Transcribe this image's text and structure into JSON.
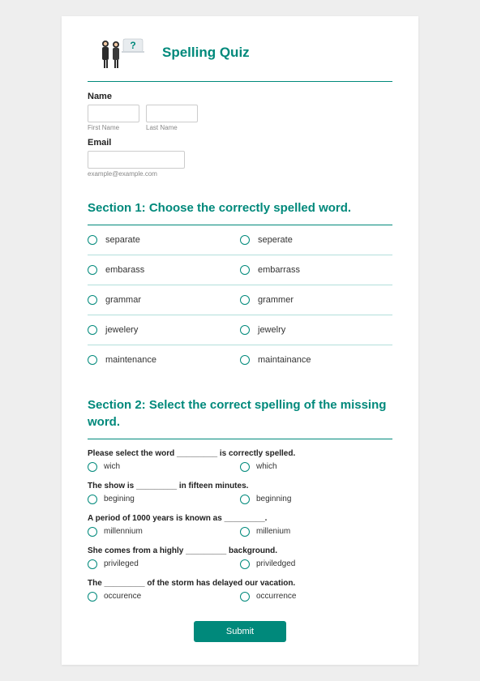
{
  "header": {
    "title": "Spelling Quiz"
  },
  "name": {
    "label": "Name",
    "first_sub": "First Name",
    "last_sub": "Last Name"
  },
  "email": {
    "label": "Email",
    "hint": "example@example.com"
  },
  "section1": {
    "title": "Section 1: Choose the correctly spelled word.",
    "questions": [
      {
        "a": "separate",
        "b": "seperate"
      },
      {
        "a": "embarass",
        "b": "embarrass"
      },
      {
        "a": "grammar",
        "b": "grammer"
      },
      {
        "a": "jewelery",
        "b": "jewelry"
      },
      {
        "a": "maintenance",
        "b": "maintainance"
      }
    ]
  },
  "section2": {
    "title": "Section 2: Select the correct spelling of the missing word.",
    "questions": [
      {
        "prompt": "Please select the word _________ is correctly spelled.",
        "a": "wich",
        "b": "which"
      },
      {
        "prompt": "The show is _________ in fifteen minutes.",
        "a": "begining",
        "b": "beginning"
      },
      {
        "prompt": "A period of 1000 years is known as _________.",
        "a": "millennium",
        "b": "millenium"
      },
      {
        "prompt": "She comes from a highly _________ background.",
        "a": "privileged",
        "b": "priviledged"
      },
      {
        "prompt": "The _________ of the storm has delayed our vacation.",
        "a": "occurence",
        "b": "occurrence"
      }
    ]
  },
  "submit": {
    "label": "Submit"
  }
}
